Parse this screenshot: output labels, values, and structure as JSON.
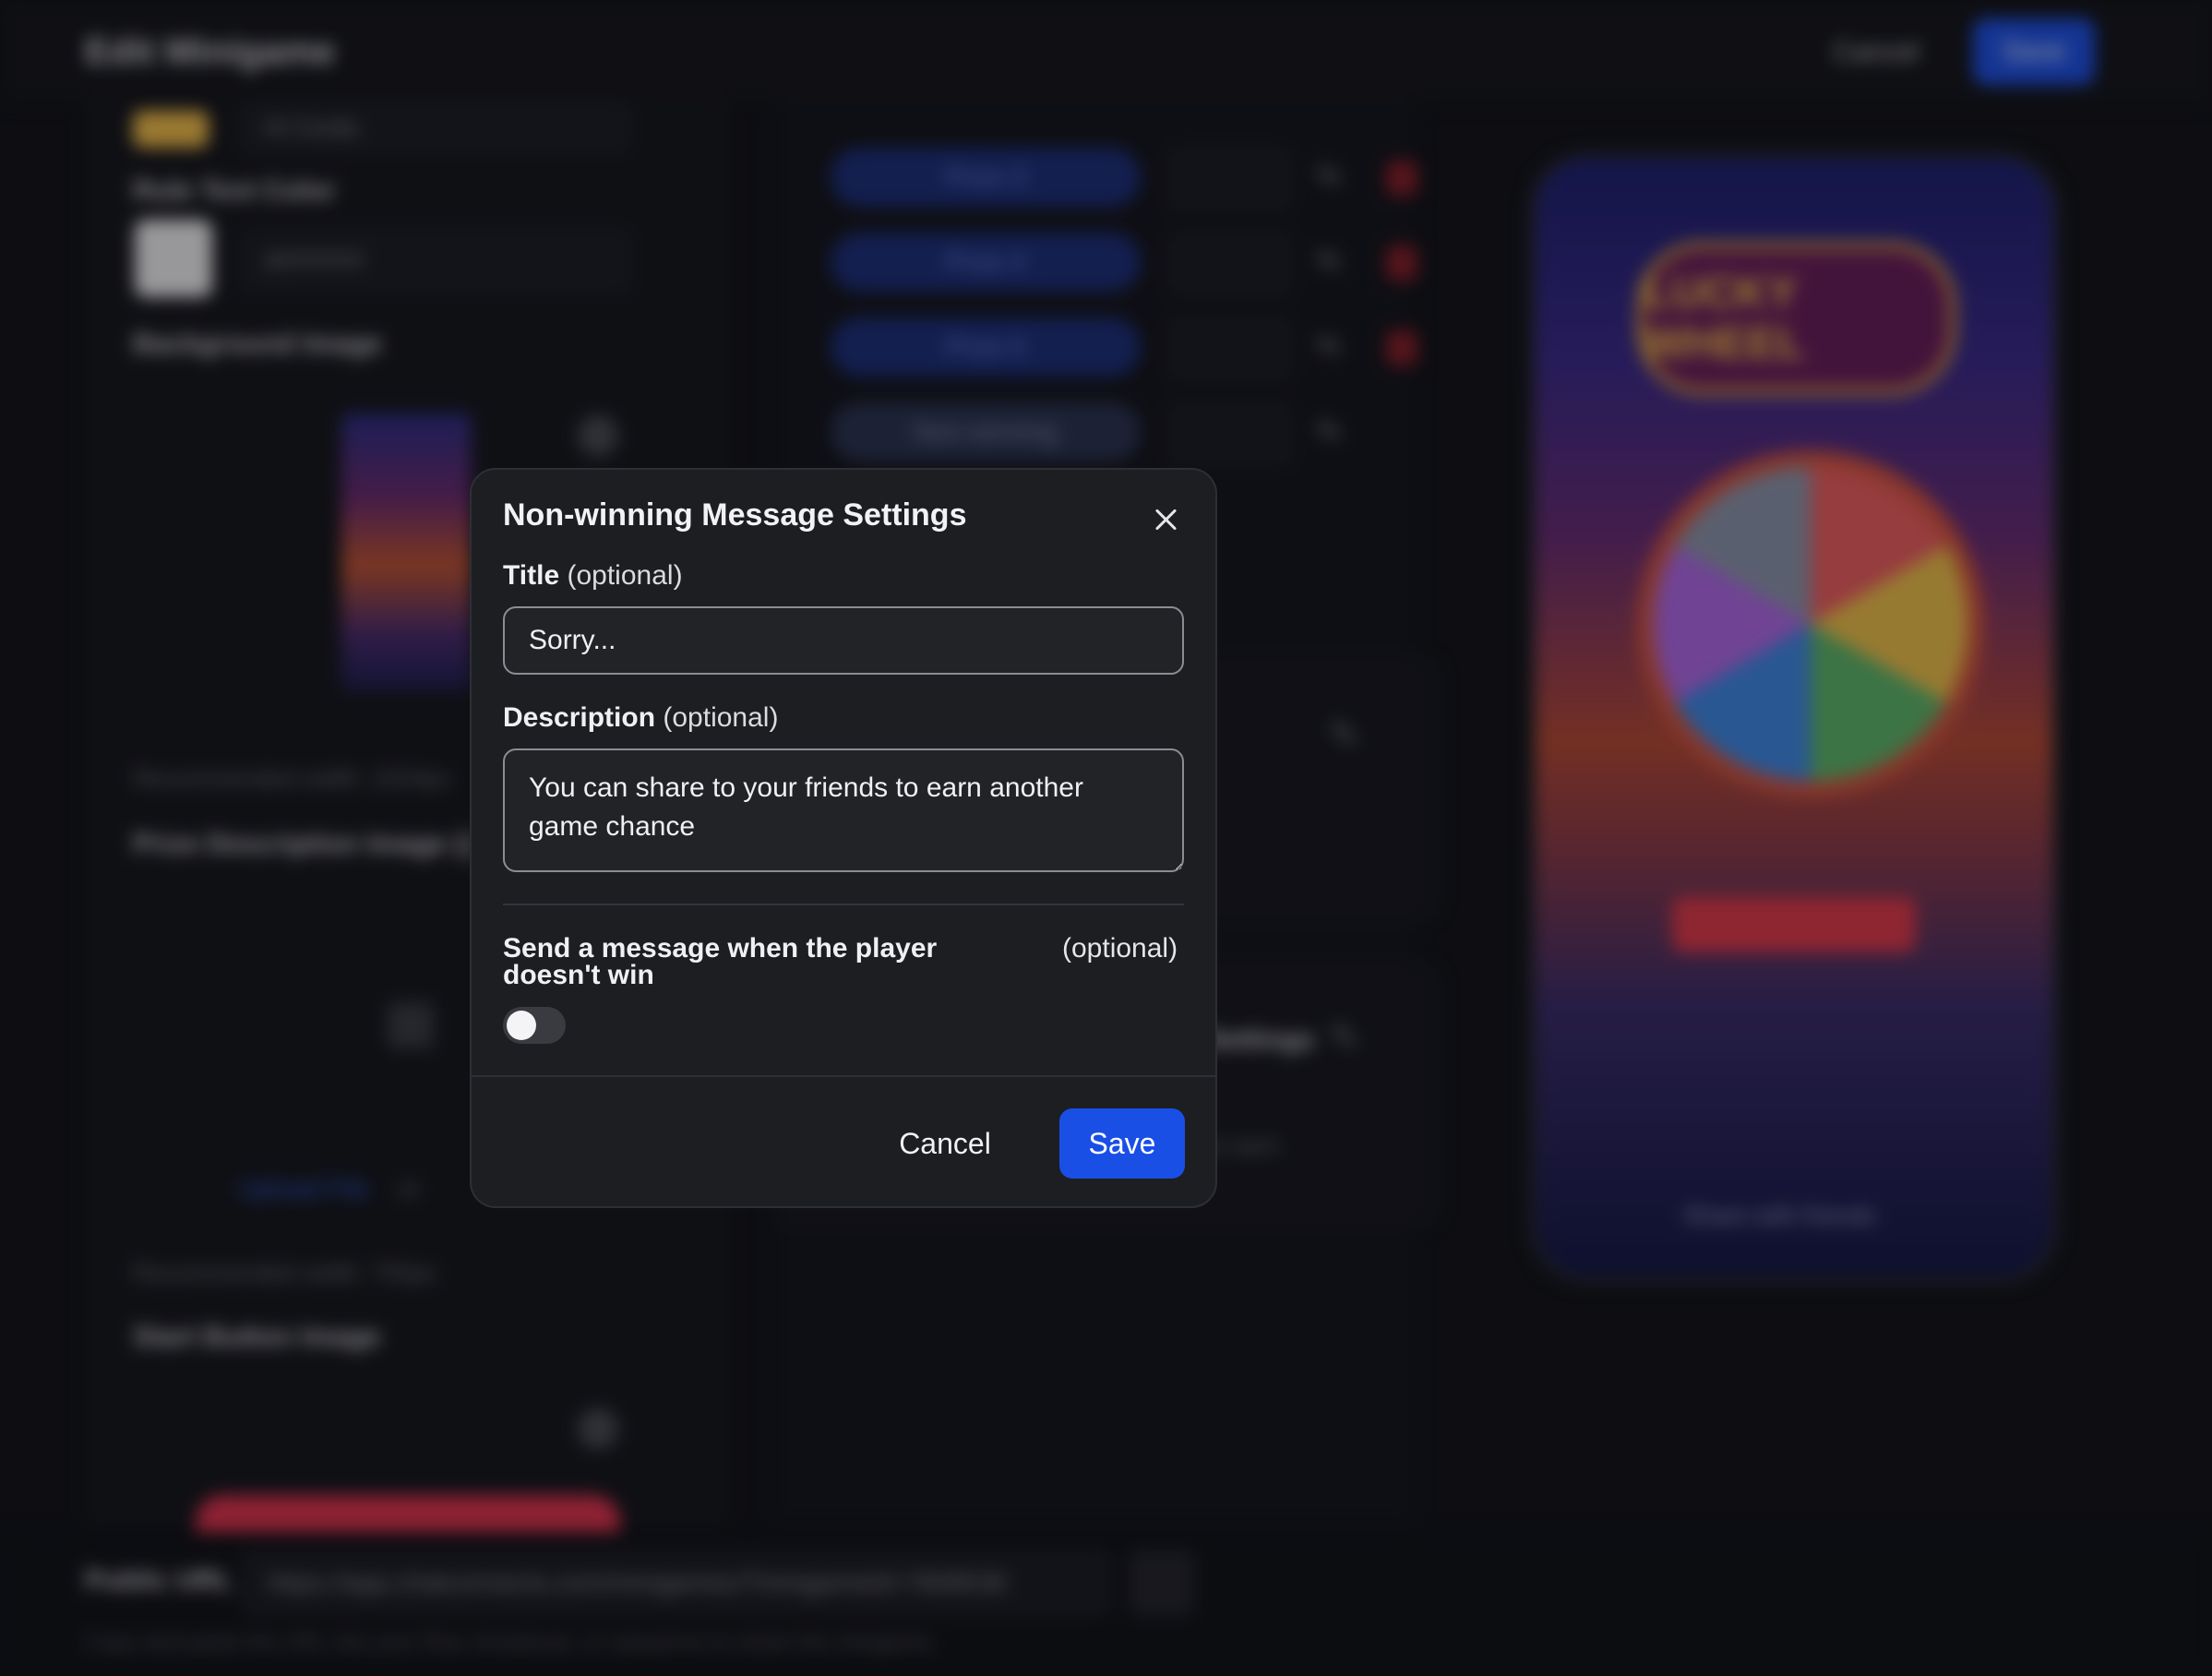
{
  "background": {
    "app_title": "Edit Minigame",
    "top_cancel": "Cancel",
    "top_save": "Save",
    "left": {
      "top_input_value": "Hi Cordo",
      "rule_text_color_label": "Rule Text Color",
      "rule_text_color_value": "#FFFFFF",
      "background_image_label": "Background Image",
      "recommended_width_1": "Recommended width: 1024px",
      "prize_description_label": "Prize Description Image ()",
      "upload_file_link": "Upload File",
      "or_text": "or",
      "recommended_width_2": "Recommended width: 750px",
      "start_button_label": "Start Button Image"
    },
    "prizes": [
      "Prize 3",
      "Prize 4",
      "Prize 5",
      "Non-winning"
    ],
    "card_text_1": "Settings",
    "card_text_2": "to earn",
    "phone": {
      "marquee_text": "LUCKY WHEEL",
      "share_text": "Share with friends"
    },
    "public_url_label": "Public URL",
    "public_url_value": "https://app.chatconnects.com/minigames/?minigameId=7808536",
    "public_url_note": "Copy and paste the URL into your flow, broadcast, or sequence to share the minigame."
  },
  "modal": {
    "title": "Non-winning Message Settings",
    "title_field": {
      "label": "Title",
      "optional": "(optional)",
      "value": "Sorry..."
    },
    "description_field": {
      "label": "Description",
      "optional": "(optional)",
      "value": "You can share to your friends to earn another game chance"
    },
    "send_message": {
      "label": "Send a message when the player doesn't win",
      "optional": "(optional)",
      "enabled": false
    },
    "cancel_label": "Cancel",
    "save_label": "Save"
  },
  "colors": {
    "primary": "#1a4fe6",
    "modal_bg": "#1d1e22",
    "page_bg": "#121317"
  }
}
